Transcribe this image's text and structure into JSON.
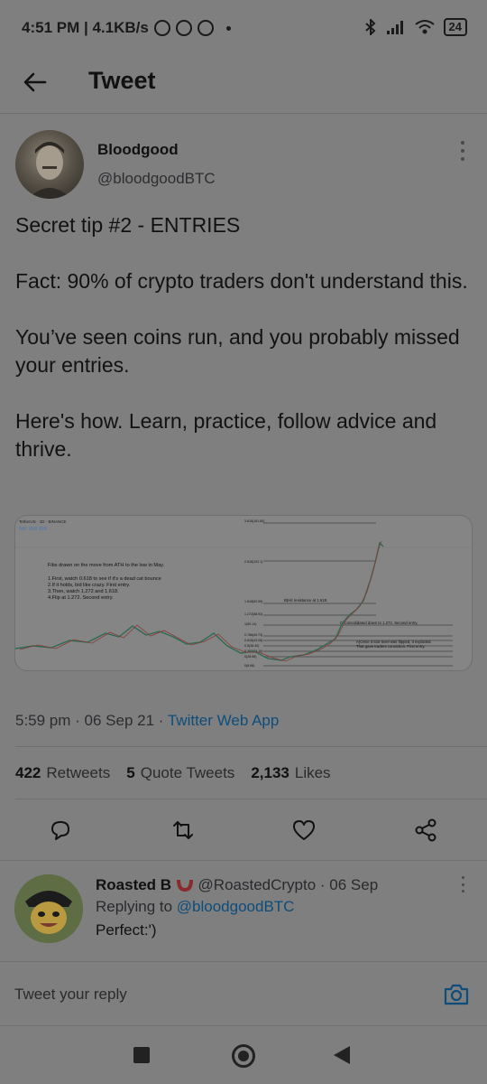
{
  "status_bar": {
    "time_speed": "4:51 PM | 4.1KB/s",
    "battery": "24"
  },
  "header": {
    "title": "Tweet"
  },
  "tweet": {
    "author_name": "Bloodgood",
    "author_handle": "@bloodgoodBTC",
    "paragraphs": [
      "Secret tip #2 - ENTRIES",
      "Fact: 90% of crypto traders don't understand this.",
      "You’ve seen coins run, and you probably missed your entries.",
      "Here's how. Learn, practice, follow advice and thrive."
    ],
    "timestamp": "5:59 pm · 06 Sep 21 · ",
    "client": "Twitter Web App"
  },
  "media": {
    "chart_header": "TetherUS · 1D · BINANCE",
    "notes": [
      "Fibs drawn on the move from ATH to the low in May.",
      "1.First, watch 0.618 to see if it's a dead cat bounce",
      "2.If it holds, bid like crazy. First entry.",
      "3.Then, watch 1.272 and 1.618.",
      "4.Flip at 1.272. Second entry."
    ],
    "fib_levels": [
      "3.618(181.60)",
      "2.618(122.1)",
      "1.618(92.59)",
      "1.272(68.93)",
      "1(50.13)",
      "0.786(40.73)",
      "0.618(43.28)",
      "0.5(38.40)",
      "0.382(34.10)",
      "0(28.56)",
      "0(8.66)"
    ],
    "annotations": [
      "B)Hit resistance at 1.618.",
      "C)Consolidated down to 1.272. Second entry.",
      "A)Once 0.618 level was flipped, it exploded.",
      "That gave traders conviction. First entry."
    ]
  },
  "stats": {
    "retweets_count": "422",
    "retweets_label": "Retweets",
    "quotes_count": "5",
    "quotes_label": "Quote Tweets",
    "likes_count": "2,133",
    "likes_label": "Likes"
  },
  "reply": {
    "name": "Roasted B",
    "handle_date": "@RoastedCrypto · 06 Sep",
    "replying_prefix": "Replying to ",
    "replying_to": "@bloodgoodBTC",
    "text": "Perfect:')"
  },
  "composer": {
    "placeholder": "Tweet your reply"
  },
  "colors": {
    "link": "#0e4d7a",
    "background": "#7f7f80"
  }
}
